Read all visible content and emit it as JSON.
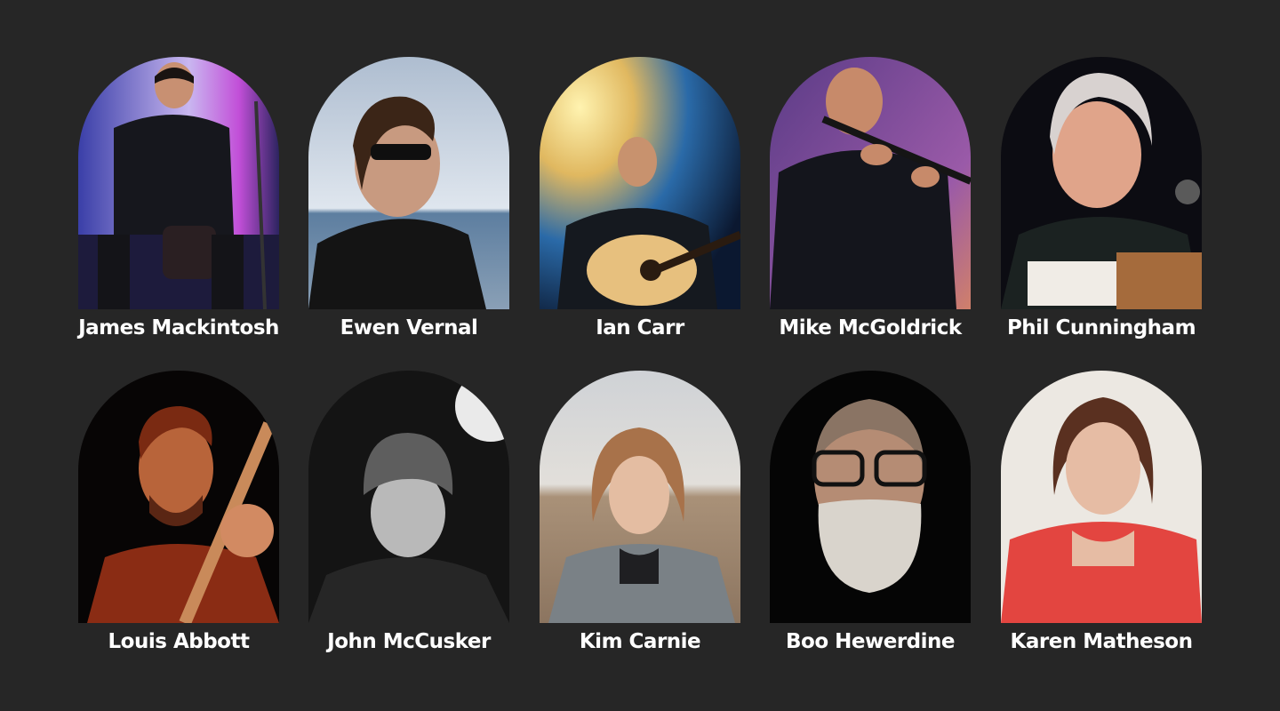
{
  "performers": [
    {
      "name": "James Mackintosh",
      "photo": "drummer-photo"
    },
    {
      "name": "Ewen Vernal",
      "photo": "sunglasses-portrait-photo"
    },
    {
      "name": "Ian Carr",
      "photo": "guitarist-photo"
    },
    {
      "name": "Mike McGoldrick",
      "photo": "flute-player-photo"
    },
    {
      "name": "Phil Cunningham",
      "photo": "accordion-player-photo"
    },
    {
      "name": "Louis Abbott",
      "photo": "guitarist-red-light-photo"
    },
    {
      "name": "John McCusker",
      "photo": "beanie-portrait-photo"
    },
    {
      "name": "Kim Carnie",
      "photo": "windswept-portrait-photo"
    },
    {
      "name": "Boo Hewerdine",
      "photo": "bearded-portrait-photo"
    },
    {
      "name": "Karen Matheson",
      "photo": "red-top-portrait-photo"
    }
  ]
}
